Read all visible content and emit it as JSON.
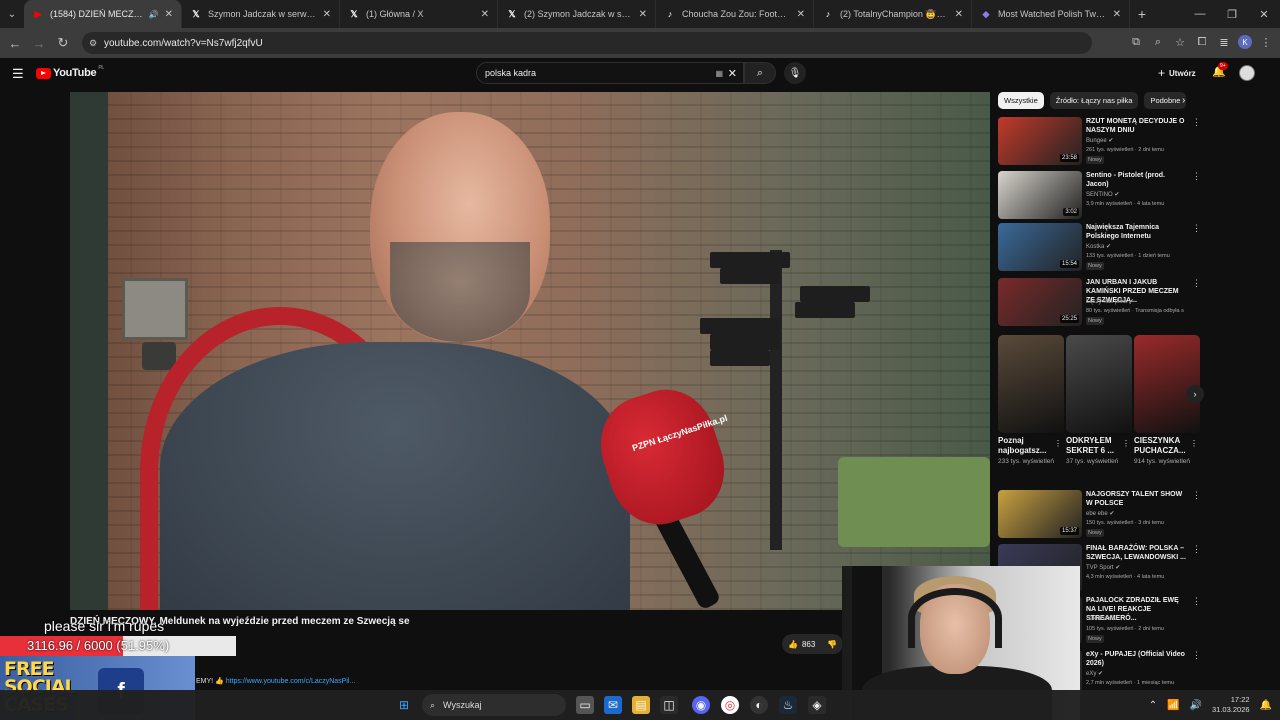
{
  "browser": {
    "tabs": [
      {
        "title": "(1584) DZIEŃ MECZOWY. M",
        "icon": "youtube-icon",
        "active": true
      },
      {
        "title": "Szymon Jadczak w serwisie X:",
        "icon": "x-icon"
      },
      {
        "title": "(1) Główna / X",
        "icon": "x-icon"
      },
      {
        "title": "(2) Szymon Jadczak w serwisie",
        "icon": "x-icon"
      },
      {
        "title": "Choucha Zou Zou: Football &",
        "icon": "tiktok-icon"
      },
      {
        "title": "(2) TotalnyChampion 🤠👊 w",
        "icon": "tiktok-icon"
      },
      {
        "title": "Most Watched Polish Twitch St",
        "icon": "stats-icon"
      }
    ],
    "url": "youtube.com/watch?v=Ns7wfj2qfvU",
    "profile_initial": "K"
  },
  "youtube": {
    "logo": "YouTube",
    "region": "PL",
    "search_value": "polska kadra",
    "create_label": "Utwórz",
    "notif_badge": "9+",
    "video_title": "DZIEŃ MECZOWY. Meldunek na wyjeździe przed meczem ze Szwecją se",
    "likes": "863",
    "channel_link_prefix": "EMY! 👍",
    "channel_link": "https://www.youtube.com/c/LaczyNasPil..."
  },
  "chips": [
    "Wszystkie",
    "Źródło: Łączy nas piłka",
    "Podobne"
  ],
  "recommendations": [
    {
      "title": "RZUT MONETĄ DECYDUJE O NASZYM DNIU",
      "channel": "Bungee ✔",
      "meta": "261 tys. wyświetleń · 2 dni temu",
      "new": "Nowy",
      "duration": "23:58",
      "color": "#c23a2a"
    },
    {
      "title": "Sentino - Pistolet (prod. Jacon)",
      "channel": "SENTINO ✔",
      "meta": "3,9 mln wyświetleń · 4 lata temu",
      "new": "",
      "duration": "3:02",
      "color": "#d8d4cc"
    },
    {
      "title": "Największa Tajemnica Polskiego Internetu",
      "channel": "Kostka ✔",
      "meta": "133 tys. wyświetleń · 1 dzień temu",
      "new": "Nowy",
      "duration": "15:54",
      "color": "#3a6a9a"
    },
    {
      "title": "JAN URBAN I JAKUB KAMIŃSKI PRZED MECZEM ZE SZWECJĄ...",
      "channel": "Łączy nas piłka ✔",
      "meta": "80 tys. wyświetleń · Transmisja odbyła s",
      "new": "Nowy",
      "duration": "25:25",
      "color": "#7a2a2a"
    }
  ],
  "shorts": [
    {
      "title": "Poznaj najbogatsz...",
      "views": "233 tys. wyświetleń",
      "color": "#5a4a3a"
    },
    {
      "title": "ODKRYŁEM SEKRET 6 ...",
      "views": "37 tys. wyświetleń",
      "color": "#4a4a4a"
    },
    {
      "title": "CIESZYNKA PUCHACZA...",
      "views": "914 tys. wyświetleń",
      "color": "#9a2a2a"
    }
  ],
  "recommendations2": [
    {
      "title": "NAJGORSZY TALENT SHOW W POLSCE",
      "channel": "ebe ebe ✔",
      "meta": "150 tys. wyświetleń · 3 dni temu",
      "new": "Nowy",
      "duration": "15:37",
      "color": "#c8a040"
    },
    {
      "title": "FINAŁ BARAŻÓW: POLSKA – SZWECJA, LEWANDOWSKI ...",
      "channel": "TVP Sport ✔",
      "meta": "4,3 mln wyświetleń · 4 lata temu",
      "new": "",
      "duration": "",
      "color": "#3a3a5a"
    },
    {
      "title": "PAJALOCK ZDRADZIŁ EWĘ NA LIVE! REAKCJE STREAMERÓ...",
      "channel": "SzklanaY2J",
      "meta": "105 tys. wyświetleń · 2 dni temu",
      "new": "Nowy",
      "duration": "",
      "color": "#2a2a2a"
    },
    {
      "title": "eXy - PUPAJEJ (Official Video 2026)",
      "channel": "eXy ✔",
      "meta": "2,7 mln wyświetleń · 1 miesiąc temu",
      "new": "",
      "duration": "",
      "color": "#3a3a3a"
    }
  ],
  "overlay": {
    "goal_message": "please sir i'm rupes",
    "goal_text": "3116.96 / 6000 (51.95%)",
    "goal_fraction": 0.5195,
    "promo_text": "FREE SOCIAL CASES",
    "promo_box": "f"
  },
  "video_overlay": {
    "mic_text": "PZPN ŁączyNasPiłka.pl"
  },
  "taskbar": {
    "search_label": "Wyszukaj",
    "time": "17:22",
    "date": "31.03.2026"
  }
}
